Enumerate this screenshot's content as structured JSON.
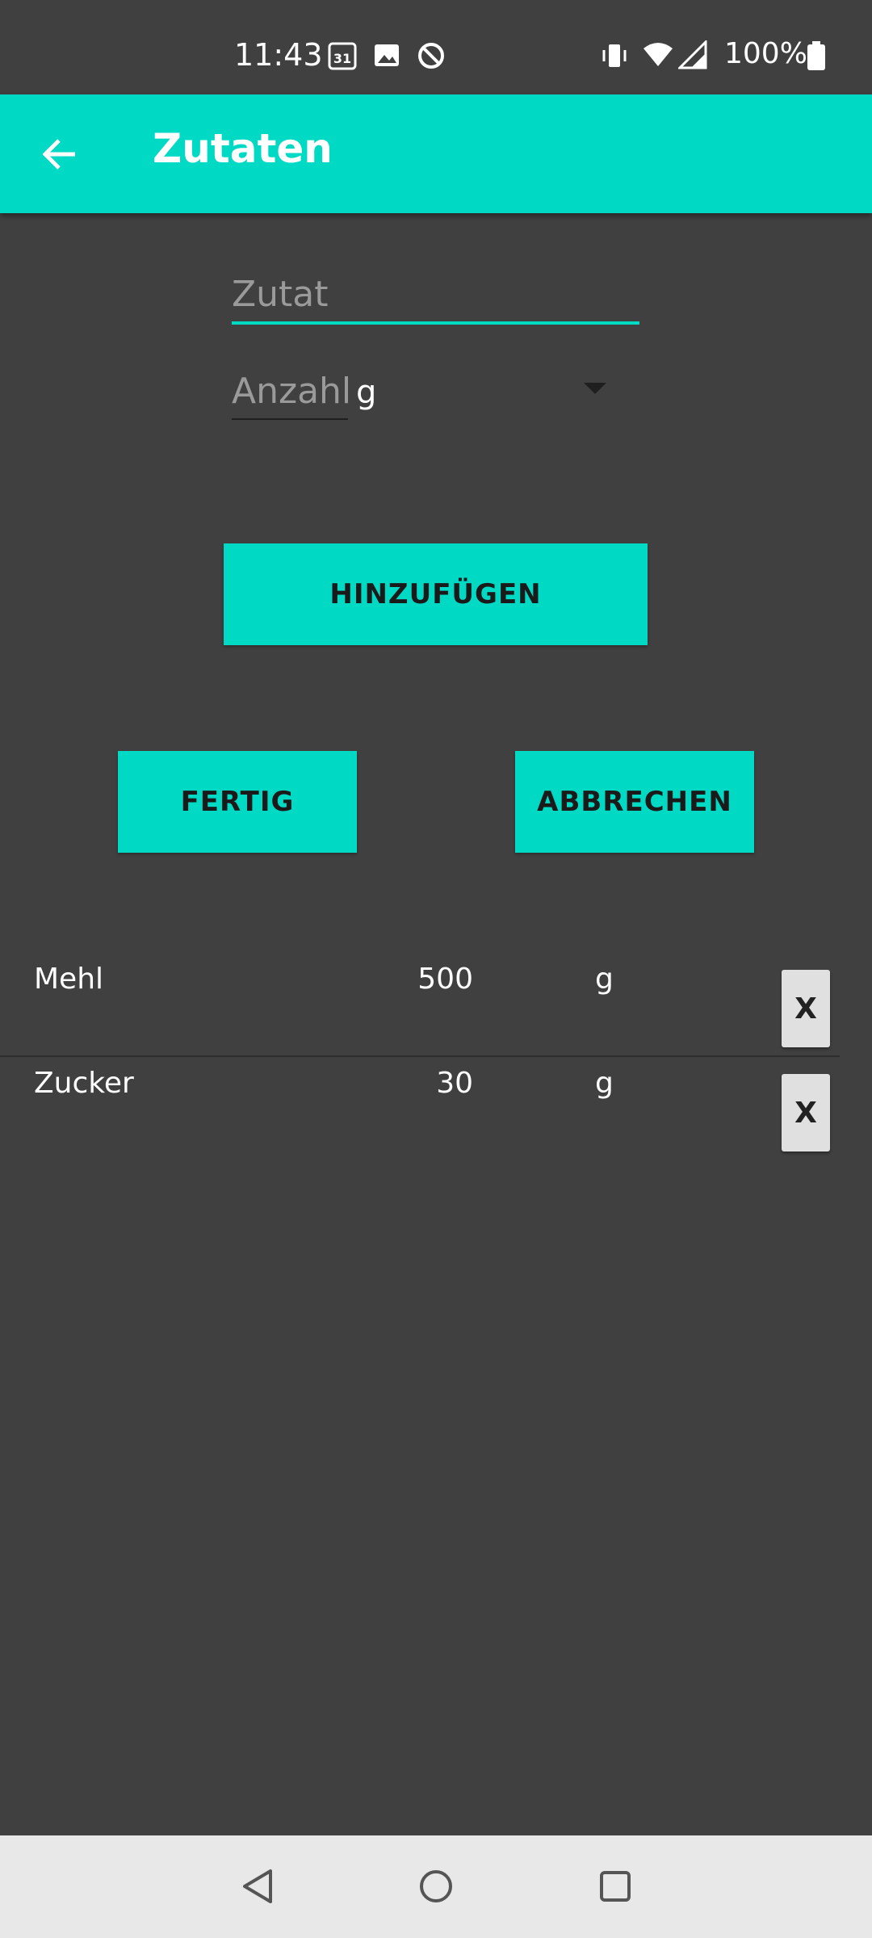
{
  "status_bar": {
    "time": "11:43",
    "battery_text": "100%",
    "icons": [
      "calendar-icon",
      "image-icon",
      "data-saver-icon",
      "vibrate-icon",
      "wifi-icon",
      "signal-icon",
      "battery-icon"
    ]
  },
  "app_bar": {
    "title": "Zutaten",
    "back_icon": "arrow-back-icon",
    "color": "#00D9C4"
  },
  "form": {
    "ingredient_placeholder": "Zutat",
    "ingredient_value": "",
    "amount_placeholder": "Anzahl",
    "amount_value": "",
    "unit_selected": "g"
  },
  "buttons": {
    "add_label": "HINZUFÜGEN",
    "done_label": "FERTIG",
    "cancel_label": "ABBRECHEN"
  },
  "ingredients": [
    {
      "name": "Mehl",
      "amount": "500",
      "unit": "g",
      "delete_label": "X"
    },
    {
      "name": "Zucker",
      "amount": "30",
      "unit": "g",
      "delete_label": "X"
    }
  ],
  "nav_bar": {
    "buttons": [
      "back-icon",
      "home-icon",
      "recents-icon"
    ]
  }
}
